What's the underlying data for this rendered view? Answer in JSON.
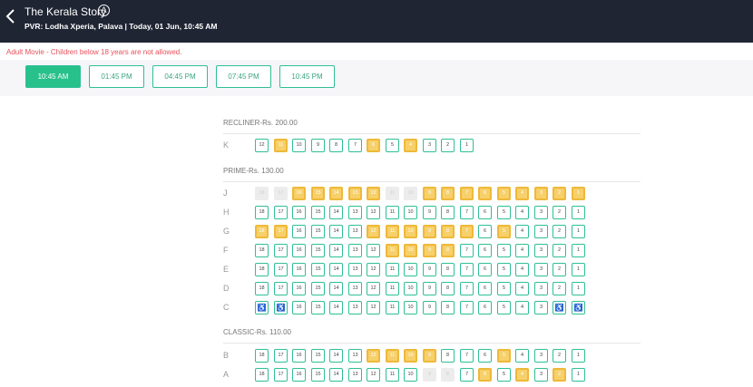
{
  "header": {
    "title": "The Kerala Story",
    "certificate": "A",
    "subtitle": "PVR: Lodha Xperia, Palava | Today, 01 Jun, 10:45 AM"
  },
  "warning": "Adult Movie - Children below 18 years are not allowed.",
  "showtimes": [
    "10:45 AM",
    "01:45 PM",
    "04:45 PM",
    "07:45 PM",
    "10:45 PM"
  ],
  "selected_showtime": "10:45 AM",
  "colors": {
    "header_bg": "#1f2533",
    "accent": "#28c18c",
    "available_border": "#2fbf95",
    "booked_fill": "#f7d06a",
    "sold_fill": "#ececec",
    "warning": "#e8505b"
  },
  "seat_legend_states": [
    "available",
    "booked",
    "sold",
    "wheelchair"
  ],
  "sections": [
    {
      "label": "RECLINER-Rs. 200.00",
      "rows": [
        {
          "row": "K",
          "seats": [
            {
              "n": "12",
              "s": "a"
            },
            {
              "n": "11",
              "s": "b"
            },
            {
              "n": "10",
              "s": "a"
            },
            {
              "n": "9",
              "s": "a"
            },
            {
              "n": "8",
              "s": "a"
            },
            {
              "n": "7",
              "s": "a"
            },
            {
              "n": "6",
              "s": "b"
            },
            {
              "n": "5",
              "s": "a"
            },
            {
              "n": "4",
              "s": "b"
            },
            {
              "n": "3",
              "s": "a"
            },
            {
              "n": "2",
              "s": "a"
            },
            {
              "n": "1",
              "s": "a"
            }
          ]
        }
      ]
    },
    {
      "label": "PRIME-Rs. 130.00",
      "rows": [
        {
          "row": "J",
          "seats": [
            {
              "n": "18",
              "s": "x"
            },
            {
              "n": "17",
              "s": "x"
            },
            {
              "n": "16",
              "s": "b"
            },
            {
              "n": "15",
              "s": "b"
            },
            {
              "n": "14",
              "s": "b"
            },
            {
              "n": "13",
              "s": "b"
            },
            {
              "n": "12",
              "s": "b"
            },
            {
              "n": "11",
              "s": "x"
            },
            {
              "n": "10",
              "s": "x"
            },
            {
              "n": "9",
              "s": "b"
            },
            {
              "n": "8",
              "s": "b"
            },
            {
              "n": "7",
              "s": "b"
            },
            {
              "n": "6",
              "s": "b"
            },
            {
              "n": "5",
              "s": "b"
            },
            {
              "n": "4",
              "s": "b"
            },
            {
              "n": "3",
              "s": "b"
            },
            {
              "n": "2",
              "s": "b"
            },
            {
              "n": "1",
              "s": "b"
            }
          ]
        },
        {
          "row": "H",
          "seats": [
            {
              "n": "18",
              "s": "a"
            },
            {
              "n": "17",
              "s": "a"
            },
            {
              "n": "16",
              "s": "a"
            },
            {
              "n": "15",
              "s": "a"
            },
            {
              "n": "14",
              "s": "a"
            },
            {
              "n": "13",
              "s": "a"
            },
            {
              "n": "12",
              "s": "a"
            },
            {
              "n": "11",
              "s": "a"
            },
            {
              "n": "10",
              "s": "a"
            },
            {
              "n": "9",
              "s": "a"
            },
            {
              "n": "8",
              "s": "a"
            },
            {
              "n": "7",
              "s": "a"
            },
            {
              "n": "6",
              "s": "a"
            },
            {
              "n": "5",
              "s": "a"
            },
            {
              "n": "4",
              "s": "a"
            },
            {
              "n": "3",
              "s": "a"
            },
            {
              "n": "2",
              "s": "a"
            },
            {
              "n": "1",
              "s": "a"
            }
          ]
        },
        {
          "row": "G",
          "seats": [
            {
              "n": "18",
              "s": "b"
            },
            {
              "n": "17",
              "s": "b"
            },
            {
              "n": "16",
              "s": "a"
            },
            {
              "n": "15",
              "s": "a"
            },
            {
              "n": "14",
              "s": "a"
            },
            {
              "n": "13",
              "s": "a"
            },
            {
              "n": "12",
              "s": "b"
            },
            {
              "n": "11",
              "s": "b"
            },
            {
              "n": "10",
              "s": "b"
            },
            {
              "n": "9",
              "s": "b"
            },
            {
              "n": "8",
              "s": "b"
            },
            {
              "n": "7",
              "s": "b"
            },
            {
              "n": "6",
              "s": "a"
            },
            {
              "n": "5",
              "s": "b"
            },
            {
              "n": "4",
              "s": "a"
            },
            {
              "n": "3",
              "s": "a"
            },
            {
              "n": "2",
              "s": "a"
            },
            {
              "n": "1",
              "s": "a"
            }
          ]
        },
        {
          "row": "F",
          "seats": [
            {
              "n": "18",
              "s": "a"
            },
            {
              "n": "17",
              "s": "a"
            },
            {
              "n": "16",
              "s": "a"
            },
            {
              "n": "15",
              "s": "a"
            },
            {
              "n": "14",
              "s": "a"
            },
            {
              "n": "13",
              "s": "a"
            },
            {
              "n": "12",
              "s": "a"
            },
            {
              "n": "11",
              "s": "b"
            },
            {
              "n": "10",
              "s": "b"
            },
            {
              "n": "9",
              "s": "b"
            },
            {
              "n": "8",
              "s": "b"
            },
            {
              "n": "7",
              "s": "a"
            },
            {
              "n": "6",
              "s": "a"
            },
            {
              "n": "5",
              "s": "a"
            },
            {
              "n": "4",
              "s": "a"
            },
            {
              "n": "3",
              "s": "a"
            },
            {
              "n": "2",
              "s": "a"
            },
            {
              "n": "1",
              "s": "a"
            }
          ]
        },
        {
          "row": "E",
          "seats": [
            {
              "n": "18",
              "s": "a"
            },
            {
              "n": "17",
              "s": "a"
            },
            {
              "n": "16",
              "s": "a"
            },
            {
              "n": "15",
              "s": "a"
            },
            {
              "n": "14",
              "s": "a"
            },
            {
              "n": "13",
              "s": "a"
            },
            {
              "n": "12",
              "s": "a"
            },
            {
              "n": "11",
              "s": "a"
            },
            {
              "n": "10",
              "s": "a"
            },
            {
              "n": "9",
              "s": "a"
            },
            {
              "n": "8",
              "s": "a"
            },
            {
              "n": "7",
              "s": "a"
            },
            {
              "n": "6",
              "s": "a"
            },
            {
              "n": "5",
              "s": "a"
            },
            {
              "n": "4",
              "s": "a"
            },
            {
              "n": "3",
              "s": "a"
            },
            {
              "n": "2",
              "s": "a"
            },
            {
              "n": "1",
              "s": "a"
            }
          ]
        },
        {
          "row": "D",
          "seats": [
            {
              "n": "18",
              "s": "a"
            },
            {
              "n": "17",
              "s": "a"
            },
            {
              "n": "16",
              "s": "a"
            },
            {
              "n": "15",
              "s": "a"
            },
            {
              "n": "14",
              "s": "a"
            },
            {
              "n": "13",
              "s": "a"
            },
            {
              "n": "12",
              "s": "a"
            },
            {
              "n": "11",
              "s": "a"
            },
            {
              "n": "10",
              "s": "a"
            },
            {
              "n": "9",
              "s": "a"
            },
            {
              "n": "8",
              "s": "a"
            },
            {
              "n": "7",
              "s": "a"
            },
            {
              "n": "6",
              "s": "a"
            },
            {
              "n": "5",
              "s": "a"
            },
            {
              "n": "4",
              "s": "a"
            },
            {
              "n": "3",
              "s": "a"
            },
            {
              "n": "2",
              "s": "a"
            },
            {
              "n": "1",
              "s": "a"
            }
          ]
        },
        {
          "row": "C",
          "seats": [
            {
              "n": "♿",
              "s": "w"
            },
            {
              "n": "♿",
              "s": "w"
            },
            {
              "n": "16",
              "s": "a"
            },
            {
              "n": "15",
              "s": "a"
            },
            {
              "n": "14",
              "s": "a"
            },
            {
              "n": "13",
              "s": "a"
            },
            {
              "n": "12",
              "s": "a"
            },
            {
              "n": "11",
              "s": "a"
            },
            {
              "n": "10",
              "s": "a"
            },
            {
              "n": "9",
              "s": "a"
            },
            {
              "n": "8",
              "s": "a"
            },
            {
              "n": "7",
              "s": "a"
            },
            {
              "n": "6",
              "s": "a"
            },
            {
              "n": "5",
              "s": "a"
            },
            {
              "n": "4",
              "s": "a"
            },
            {
              "n": "3",
              "s": "a"
            },
            {
              "n": "♿",
              "s": "w"
            },
            {
              "n": "♿",
              "s": "w"
            }
          ]
        }
      ]
    },
    {
      "label": "CLASSIC-Rs. 110.00",
      "rows": [
        {
          "row": "B",
          "seats": [
            {
              "n": "18",
              "s": "a"
            },
            {
              "n": "17",
              "s": "a"
            },
            {
              "n": "16",
              "s": "a"
            },
            {
              "n": "15",
              "s": "a"
            },
            {
              "n": "14",
              "s": "a"
            },
            {
              "n": "13",
              "s": "a"
            },
            {
              "n": "12",
              "s": "b"
            },
            {
              "n": "11",
              "s": "b"
            },
            {
              "n": "10",
              "s": "b"
            },
            {
              "n": "9",
              "s": "b"
            },
            {
              "n": "8",
              "s": "a"
            },
            {
              "n": "7",
              "s": "a"
            },
            {
              "n": "6",
              "s": "a"
            },
            {
              "n": "5",
              "s": "b"
            },
            {
              "n": "4",
              "s": "a"
            },
            {
              "n": "3",
              "s": "a"
            },
            {
              "n": "2",
              "s": "a"
            },
            {
              "n": "1",
              "s": "a"
            }
          ]
        },
        {
          "row": "A",
          "seats": [
            {
              "n": "18",
              "s": "a"
            },
            {
              "n": "17",
              "s": "a"
            },
            {
              "n": "16",
              "s": "a"
            },
            {
              "n": "15",
              "s": "a"
            },
            {
              "n": "14",
              "s": "a"
            },
            {
              "n": "13",
              "s": "a"
            },
            {
              "n": "12",
              "s": "a"
            },
            {
              "n": "11",
              "s": "a"
            },
            {
              "n": "10",
              "s": "a"
            },
            {
              "n": "9",
              "s": "x"
            },
            {
              "n": "8",
              "s": "x"
            },
            {
              "n": "7",
              "s": "a"
            },
            {
              "n": "6",
              "s": "b"
            },
            {
              "n": "5",
              "s": "a"
            },
            {
              "n": "4",
              "s": "b"
            },
            {
              "n": "3",
              "s": "a"
            },
            {
              "n": "2",
              "s": "b"
            },
            {
              "n": "1",
              "s": "a"
            }
          ]
        }
      ]
    }
  ]
}
